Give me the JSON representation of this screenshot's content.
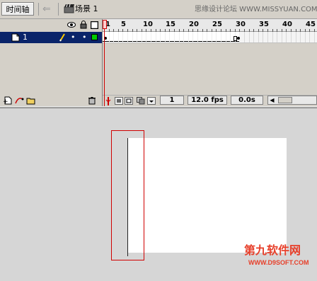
{
  "topbar": {
    "timeline_button": "时间轴",
    "scene_label": "场景 1",
    "watermark": "思缘设计论坛 WWW.MISSYUAN.COM"
  },
  "layers": {
    "items": [
      {
        "name": "1",
        "selected": true,
        "color": "#00cc00"
      }
    ]
  },
  "ruler": {
    "ticks": [
      "1",
      "5",
      "10",
      "15",
      "20",
      "25",
      "30",
      "35",
      "40",
      "45"
    ]
  },
  "status": {
    "current_frame": "1",
    "frame_rate": "12.0 fps",
    "elapsed_time": "0.0s"
  },
  "watermark_bottom": {
    "brand": "第九软件网",
    "url": "WWW.D9SOFT.COM"
  },
  "colors": {
    "selected_row": "#0a246a",
    "playhead": "#cc0000",
    "highlight": "#d00000"
  }
}
